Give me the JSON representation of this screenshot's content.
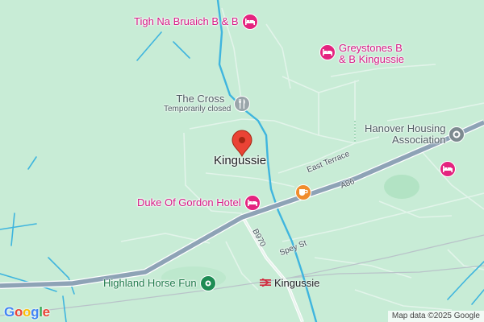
{
  "map": {
    "town_name": "Kingussie",
    "attribution": "Map data ©2025 Google",
    "logo": [
      "G",
      "o",
      "o",
      "g",
      "l",
      "e"
    ],
    "logo_colors": [
      "#4285F4",
      "#EA4335",
      "#FBBC05",
      "#4285F4",
      "#34A853",
      "#EA4335"
    ]
  },
  "roads": {
    "a86": "A86",
    "b970": "B970",
    "east_terrace": "East Terrace",
    "spey_st": "Spey St"
  },
  "pois": {
    "tigh_na_bruaich": "Tigh Na Bruaich B & B",
    "greystones": [
      "Greystones B",
      "& B Kingussie"
    ],
    "the_cross": "The Cross",
    "the_cross_status": "Temporarily closed",
    "hanover": [
      "Hanover Housing",
      "Association"
    ],
    "duke_of_gordon": "Duke Of Gordon Hotel",
    "highland_horse_fun": "Highland Horse Fun",
    "station": "Kingussie"
  },
  "colors": {
    "land": "#c8ecd6",
    "water": "#3fb5de",
    "highway": "#8ea3b6",
    "hotel": "#e4247f",
    "cafe": "#f08c2c",
    "park": "#1e8c54",
    "generic": "#7d8a90",
    "rail": "#d2273c"
  }
}
